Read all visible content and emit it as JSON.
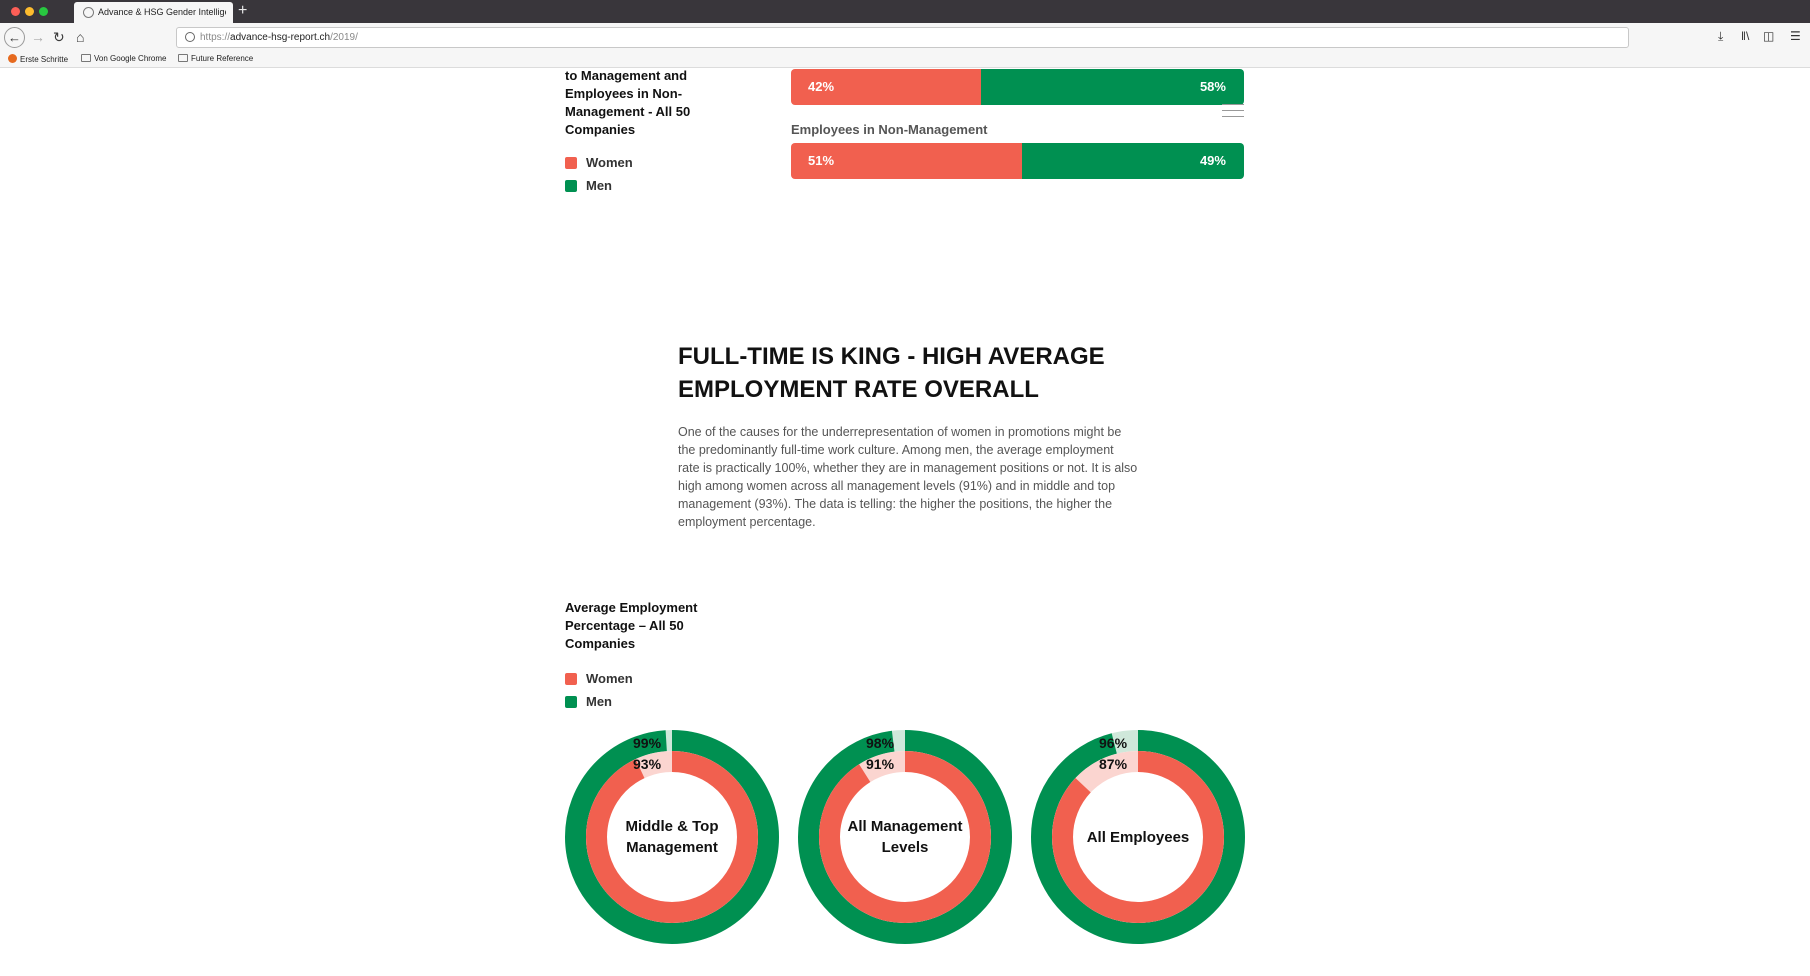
{
  "browser": {
    "tab_title": "Advance & HSG Gender Intellige",
    "url_protocol": "https://",
    "url_host": "advance-hsg-report.ch",
    "url_path": "/2019/",
    "bookmarks": [
      "Erste Schritte",
      "Von Google Chrome",
      "Future Reference"
    ]
  },
  "legend": {
    "women_label": "Women",
    "men_label": "Men",
    "women_color": "#f1604f",
    "men_color": "#009051"
  },
  "top_chart": {
    "title": "to Management and Employees in Non-Management - All 50 Companies",
    "bars": [
      {
        "label": "",
        "women_pct": "42%",
        "men_pct": "58%",
        "women_value": 42,
        "men_value": 58
      },
      {
        "label": "Employees in Non-Management",
        "women_pct": "51%",
        "men_pct": "49%",
        "women_value": 51,
        "men_value": 49
      }
    ]
  },
  "section": {
    "title": "FULL-TIME IS KING - HIGH AVERAGE EMPLOYMENT RATE OVERALL",
    "body": "One of the causes for the underrepresentation of women in promotions might be the predominantly full-time work culture. Among men, the average employment rate is practically 100%, whether they are in management positions or not. It is also high among women across all management levels (91%) and in middle and top management (93%). The data is telling: the higher the positions, the higher the employment percentage."
  },
  "donut_chart": {
    "title": "Average Employment Percentage – All 50 Companies",
    "donuts": [
      {
        "label": "Middle & Top Management",
        "men_pct": "99%",
        "women_pct": "93%",
        "men_value": 99,
        "women_value": 93
      },
      {
        "label": "All Management Levels",
        "men_pct": "98%",
        "women_pct": "91%",
        "men_value": 98,
        "women_value": 91
      },
      {
        "label": "All Employees",
        "men_pct": "96%",
        "women_pct": "87%",
        "men_value": 96,
        "women_value": 87
      }
    ]
  },
  "chart_data": [
    {
      "type": "bar",
      "orientation": "horizontal-stacked",
      "categories": [
        "",
        "Employees in Non-Management"
      ],
      "series": [
        {
          "name": "Women",
          "values": [
            42,
            51
          ]
        },
        {
          "name": "Men",
          "values": [
            58,
            49
          ]
        }
      ],
      "title": "to Management and Employees in Non-Management - All 50 Companies"
    },
    {
      "type": "pie",
      "subtype": "nested-donut",
      "categories": [
        "Middle & Top Management",
        "All Management Levels",
        "All Employees"
      ],
      "series": [
        {
          "name": "Men",
          "values": [
            99,
            98,
            96
          ]
        },
        {
          "name": "Women",
          "values": [
            93,
            91,
            87
          ]
        }
      ],
      "title": "Average Employment Percentage – All 50 Companies"
    }
  ]
}
